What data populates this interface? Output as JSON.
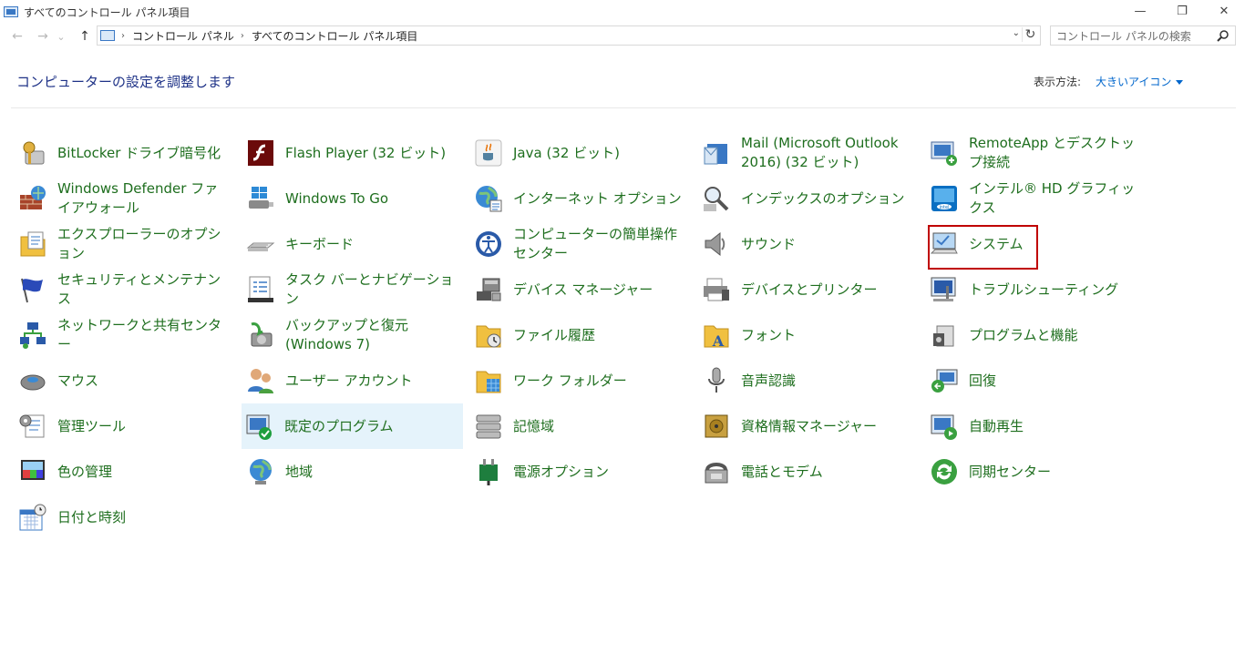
{
  "window": {
    "title": "すべてのコントロール パネル項目",
    "controls": {
      "minimize": "—",
      "restore": "❐",
      "close": "✕"
    }
  },
  "nav": {
    "back": "←",
    "forward": "→",
    "recent": "⌄",
    "up": "↑",
    "breadcrumbs": [
      "コントロール パネル",
      "すべてのコントロール パネル項目"
    ],
    "dropdown": "⌄",
    "refresh": "↻"
  },
  "search": {
    "placeholder": "コントロール パネルの検索"
  },
  "header": {
    "title": "コンピューターの設定を調整します",
    "view_by_label": "表示方法:",
    "view_by_value": "大きいアイコン"
  },
  "items": [
    [
      "BitLocker ドライブ暗号化",
      "Flash Player (32 ビット)",
      "Java (32 ビット)",
      "Mail (Microsoft Outlook 2016) (32 ビット)",
      "RemoteApp とデスクトップ接続"
    ],
    [
      "Windows Defender ファイアウォール",
      "Windows To Go",
      "インターネット オプション",
      "インデックスのオプション",
      "インテル® HD グラフィックス"
    ],
    [
      "エクスプローラーのオプション",
      "キーボード",
      "コンピューターの簡単操作センター",
      "サウンド",
      "システム"
    ],
    [
      "セキュリティとメンテナンス",
      "タスク バーとナビゲーション",
      "デバイス マネージャー",
      "デバイスとプリンター",
      "トラブルシューティング"
    ],
    [
      "ネットワークと共有センター",
      "バックアップと復元 (Windows 7)",
      "ファイル履歴",
      "フォント",
      "プログラムと機能"
    ],
    [
      "マウス",
      "ユーザー アカウント",
      "ワーク フォルダー",
      "音声認識",
      "回復"
    ],
    [
      "管理ツール",
      "既定のプログラム",
      "記憶域",
      "資格情報マネージャー",
      "自動再生"
    ],
    [
      "色の管理",
      "地域",
      "電源オプション",
      "電話とモデム",
      "同期センター"
    ],
    [
      "日付と時刻"
    ]
  ],
  "icons": [
    [
      "bitlocker-key-icon",
      "flash-player-icon",
      "java-cup-icon",
      "mail-icon",
      "remoteapp-icon"
    ],
    [
      "firewall-icon",
      "usb-drive-icon",
      "internet-globe-icon",
      "index-search-icon",
      "intel-graphics-icon"
    ],
    [
      "folder-options-icon",
      "keyboard-icon",
      "ease-of-access-icon",
      "speaker-icon",
      "system-computer-icon"
    ],
    [
      "security-flag-icon",
      "taskbar-icon",
      "device-manager-icon",
      "printer-icon",
      "troubleshoot-icon"
    ],
    [
      "network-icon",
      "backup-restore-icon",
      "file-history-icon",
      "font-icon",
      "programs-icon"
    ],
    [
      "mouse-icon",
      "user-accounts-icon",
      "work-folders-icon",
      "microphone-icon",
      "recovery-icon"
    ],
    [
      "admin-tools-icon",
      "default-programs-icon",
      "storage-icon",
      "credential-vault-icon",
      "autoplay-icon"
    ],
    [
      "color-management-icon",
      "region-globe-icon",
      "power-plug-icon",
      "phone-modem-icon",
      "sync-icon"
    ],
    [
      "calendar-clock-icon"
    ]
  ],
  "colors": {
    "link_green": "#1e6e1e",
    "title_blue": "#1e3287",
    "accent_blue": "#0066cc",
    "hover_bg": "#e5f3fb",
    "highlight_red": "#c00000"
  },
  "state": {
    "hovered_item": "既定のプログラム",
    "highlighted_item": "システム"
  }
}
